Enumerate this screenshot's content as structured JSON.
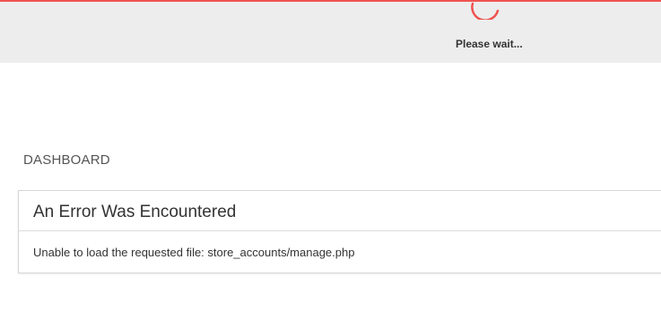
{
  "loading": {
    "text": "Please wait...",
    "accent_color": "#ef5350",
    "background_color": "#ededed"
  },
  "main": {
    "section_title": "DASHBOARD",
    "error": {
      "title": "An Error Was Encountered",
      "message": "Unable to load the requested file: store_accounts/manage.php"
    }
  }
}
